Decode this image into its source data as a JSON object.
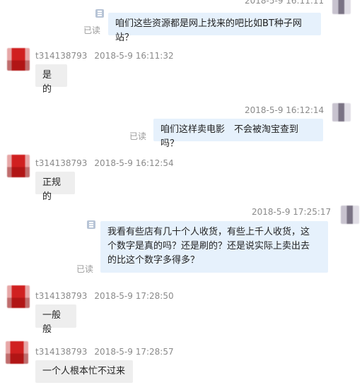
{
  "messages": [
    {
      "side": "right",
      "timestamp": "2018-5-9 16:11:11",
      "text": "咱们这些资源都是网上找来的吧比如BT种子网站？",
      "status": "已读"
    },
    {
      "side": "left",
      "user": "t314138793",
      "timestamp": "2018-5-9 16:11:32",
      "text": "是的"
    },
    {
      "side": "right",
      "timestamp": "2018-5-9 16:12:14",
      "text": "咱们这样卖电影　不会被淘宝查到吗？",
      "status": "已读"
    },
    {
      "side": "left",
      "user": "t314138793",
      "timestamp": "2018-5-9 16:12:54",
      "text": "正规的"
    },
    {
      "side": "right",
      "timestamp": "2018-5-9 17:25:17",
      "text_lines": [
        "我看有些店有几十个人收货，有些上千人收货，这",
        "个数字是真的吗？还是刷的？还是说实际上卖出去",
        "的比这个数字多得多？"
      ],
      "status": "已读"
    },
    {
      "side": "left",
      "user": "t314138793",
      "timestamp": "2018-5-9 17:28:50",
      "text": "一般般"
    },
    {
      "side": "left",
      "user": "t314138793",
      "timestamp": "2018-5-9 17:28:57",
      "text": "一个人根本忙不过来"
    }
  ]
}
